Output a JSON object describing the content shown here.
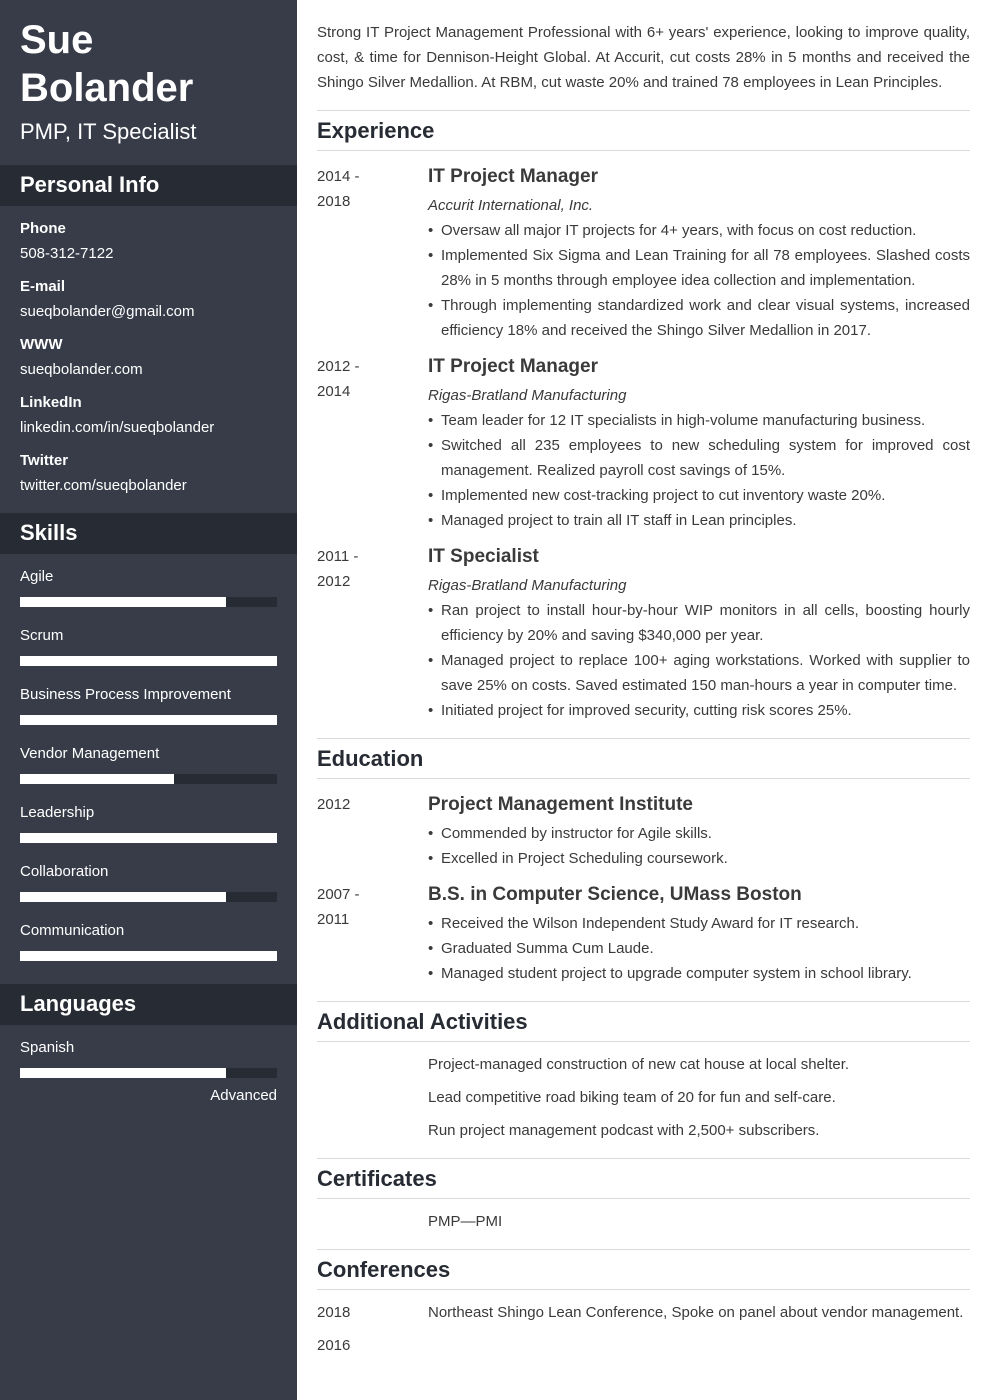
{
  "header": {
    "first_name": "Sue",
    "last_name": "Bolander",
    "title": "PMP, IT Specialist"
  },
  "personal_info": {
    "heading": "Personal Info",
    "items": [
      {
        "label": "Phone",
        "value": "508-312-7122"
      },
      {
        "label": "E-mail",
        "value": "sueqbolander@gmail.com"
      },
      {
        "label": "WWW",
        "value": "sueqbolander.com"
      },
      {
        "label": "LinkedIn",
        "value": "linkedin.com/in/sueqbolander"
      },
      {
        "label": "Twitter",
        "value": "twitter.com/sueqbolander"
      }
    ]
  },
  "skills": {
    "heading": "Skills",
    "items": [
      {
        "name": "Agile",
        "level": 0.8
      },
      {
        "name": "Scrum",
        "level": 1.0
      },
      {
        "name": "Business Process Improvement",
        "level": 1.0
      },
      {
        "name": "Vendor Management",
        "level": 0.6
      },
      {
        "name": "Leadership",
        "level": 1.0
      },
      {
        "name": "Collaboration",
        "level": 0.8
      },
      {
        "name": "Communication",
        "level": 1.0
      }
    ]
  },
  "languages": {
    "heading": "Languages",
    "items": [
      {
        "name": "Spanish",
        "level": 0.8,
        "level_label": "Advanced"
      }
    ]
  },
  "summary": "Strong IT Project Management Professional with 6+ years' experience, looking to improve quality, cost, & time for Dennison-Height Global. At Accurit, cut costs 28% in 5 months and received the Shingo Silver Medallion. At RBM, cut waste 20% and trained 78 employees in Lean Principles.",
  "experience": {
    "heading": "Experience",
    "items": [
      {
        "date_start": "2014 -",
        "date_end": "2018",
        "title": "IT Project Manager",
        "org": "Accurit International, Inc.",
        "bullets": [
          "Oversaw all major IT projects for 4+ years, with focus on cost reduction.",
          "Implemented Six Sigma and Lean Training for all 78 employees. Slashed costs 28% in 5 months through employee idea collection and implementation.",
          "Through implementing standardized work and clear visual systems, increased efficiency 18% and received the Shingo Silver Medallion in 2017."
        ]
      },
      {
        "date_start": "2012 -",
        "date_end": "2014",
        "title": "IT Project Manager",
        "org": "Rigas-Bratland Manufacturing",
        "bullets": [
          "Team leader for 12 IT specialists in high-volume manufacturing business.",
          "Switched all 235 employees to new scheduling system for improved cost management. Realized payroll cost savings of 15%.",
          "Implemented new cost-tracking project to cut inventory waste 20%.",
          "Managed project to train all IT staff in Lean principles."
        ]
      },
      {
        "date_start": "2011 -",
        "date_end": "2012",
        "title": "IT Specialist",
        "org": "Rigas-Bratland Manufacturing",
        "bullets": [
          "Ran project to install hour-by-hour WIP monitors in all cells, boosting hourly efficiency by 20% and saving $340,000 per year.",
          "Managed project to replace 100+ aging workstations. Worked with supplier to save 25% on costs. Saved estimated 150 man-hours a year in computer time.",
          "Initiated project for improved security, cutting risk scores 25%."
        ]
      }
    ]
  },
  "education": {
    "heading": "Education",
    "items": [
      {
        "date_start": "2012",
        "date_end": "",
        "title": "Project Management Institute",
        "bullets": [
          "Commended by instructor for Agile skills.",
          "Excelled in Project Scheduling coursework."
        ]
      },
      {
        "date_start": "2007 -",
        "date_end": "2011",
        "title": "B.S. in Computer Science, UMass Boston",
        "bullets": [
          "Received the Wilson Independent Study Award for IT research.",
          "Graduated Summa Cum Laude.",
          "Managed student project to upgrade computer system in school library."
        ]
      }
    ]
  },
  "activities": {
    "heading": "Additional Activities",
    "items": [
      "Project-managed construction of new cat house at local shelter.",
      "Lead competitive road biking team of 20 for fun and self-care.",
      "Run project management podcast with 2,500+ subscribers."
    ]
  },
  "certificates": {
    "heading": "Certificates",
    "items": [
      "PMP—PMI"
    ]
  },
  "conferences": {
    "heading": "Conferences",
    "items": [
      {
        "year": "2018",
        "text": "Northeast Shingo Lean Conference, Spoke on panel about vendor management."
      },
      {
        "year": "2016",
        "text": ""
      }
    ]
  },
  "colors": {
    "sidebar_bg": "#373c48",
    "sidebar_header_bg": "#272b33",
    "bar_track": "#272b33",
    "bar_fill": "#ffffff",
    "heading_text": "#272b33",
    "body_text": "#3a3a3a",
    "rule": "#d9d9d9"
  }
}
